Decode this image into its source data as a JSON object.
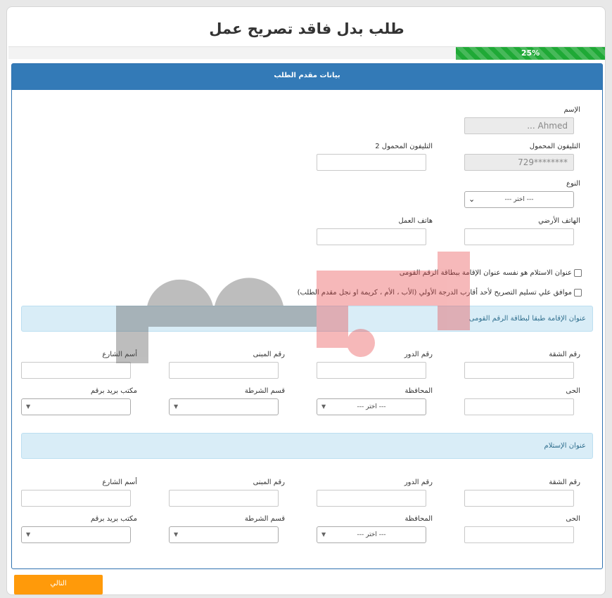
{
  "title": "طلب بدل فاقد تصريح عمل",
  "progress": {
    "label": "25%",
    "value": 0.25
  },
  "panel_heading": "بيانات مقدم الطلب",
  "applicant": {
    "name_label": "الإسم",
    "name_value": "Ahmed ...",
    "mobile_label": "التليفون المحمول",
    "mobile_value": "********729",
    "mobile2_label": "التليفون المحمول 2",
    "mobile2_value": "",
    "gender_label": "النوع",
    "gender_value": "--- اختر ---",
    "landline_label": "الهاتف الأرضي",
    "landline_value": "",
    "work_phone_label": "هاتف العمل",
    "work_phone_value": ""
  },
  "checkboxes": {
    "same_address": "عنوان الاستلام هو نفسه عنوان الإقامة ببطاقة الرقم القومى",
    "delegate_consent": "موافق علي تسليم التصريح لأحد أقارب الدرجة الأولي (الأب ، الأم ، كريمة او نجل مقدم الطلب)"
  },
  "residence_address": {
    "heading": "عنوان الإقامة طبقا لبطاقة الرقم القومى",
    "apartment_label": "رقم الشقة",
    "floor_label": "رقم الدور",
    "building_label": "رقم المبنى",
    "street_label": "أسم الشارع",
    "district_label": "الحى",
    "governorate_label": "المحافظة",
    "governorate_value": "--- اختر ---",
    "police_label": "قسم الشرطة",
    "postal_label": "مكتب بريد برقم"
  },
  "delivery_address": {
    "heading": "عنوان الإستلام",
    "apartment_label": "رقم الشقة",
    "floor_label": "رقم الدور",
    "building_label": "رقم المبنى",
    "street_label": "أسم الشارع",
    "district_label": "الحى",
    "governorate_label": "المحافظة",
    "governorate_value": "--- اختر ---",
    "police_label": "قسم الشرطة",
    "postal_label": "مكتب بريد برقم"
  },
  "next_button": "التالي",
  "colors": {
    "primary": "#337ab7",
    "progress": "#1fa936",
    "info_bg": "#d9edf7",
    "button": "#ff9a0a",
    "watermark_red": "#e8474a",
    "watermark_gray": "#555555"
  }
}
